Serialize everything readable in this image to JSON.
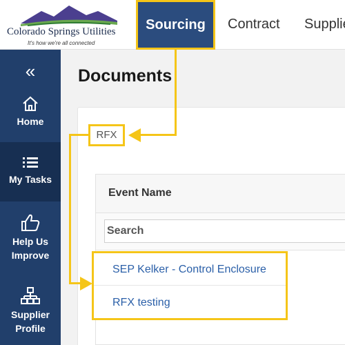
{
  "header": {
    "logo": {
      "name": "Colorado Springs Utilities",
      "tagline": "It's how we're all connected"
    },
    "nav_tabs": [
      {
        "label": "Sourcing",
        "active": true
      },
      {
        "label": "Contract",
        "active": false
      },
      {
        "label": "Supplie",
        "active": false
      }
    ]
  },
  "sidebar": {
    "collapse_icon": "double-chevron-left",
    "items": [
      {
        "label": "Home",
        "icon": "home-icon"
      },
      {
        "label": "My Tasks",
        "icon": "list-icon",
        "active": true
      },
      {
        "label": "Help Us Improve",
        "icon": "thumbs-up-icon"
      },
      {
        "label": "Supplier Profile",
        "icon": "sitemap-icon"
      }
    ]
  },
  "main": {
    "title": "Documents",
    "breadcrumb": "RFX",
    "table": {
      "column_header": "Event Name",
      "search_placeholder": "Search",
      "rows": [
        "SEP Kelker - Control Enclosure",
        "RFX testing"
      ]
    }
  },
  "colors": {
    "sidebar": "#213f6b",
    "active_tab": "#2b4c7e",
    "highlight": "#f5c518",
    "link": "#2a5fa8"
  }
}
